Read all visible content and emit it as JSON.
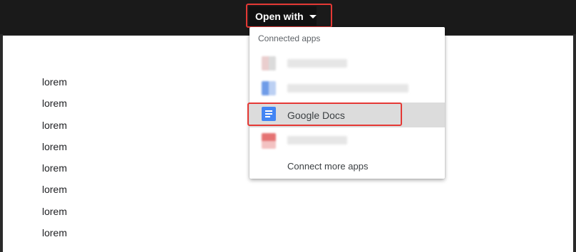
{
  "toolbar": {
    "open_with_label": "Open with"
  },
  "menu": {
    "header": "Connected apps",
    "items": [
      {
        "label": "",
        "icon": "blurred-app-icon"
      },
      {
        "label": "",
        "icon": "blurred-app-icon"
      },
      {
        "label": "Google Docs",
        "icon": "google-docs-icon",
        "selected": true
      },
      {
        "label": "",
        "icon": "blurred-app-icon"
      }
    ],
    "connect_more": "Connect more apps"
  },
  "document": {
    "lines": [
      "lorem",
      "lorem",
      "lorem",
      "lorem",
      "lorem",
      "lorem",
      "lorem",
      "lorem"
    ]
  },
  "colors": {
    "highlight": "#e53935",
    "docs_blue": "#4285f4"
  }
}
